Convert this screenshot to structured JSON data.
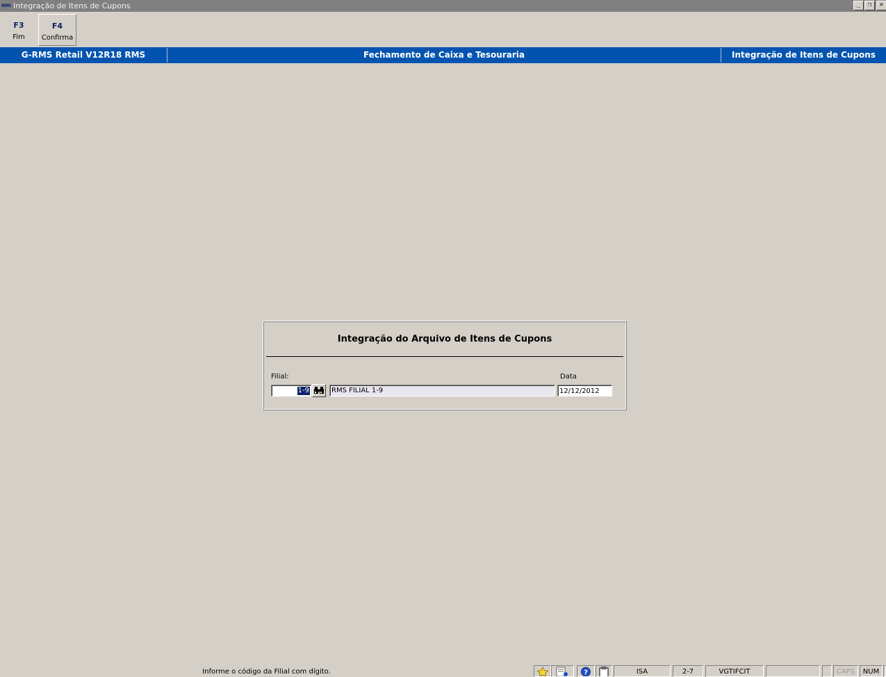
{
  "window": {
    "app_icon_text": "RMS",
    "title": "Integração de Itens de Cupons",
    "controls": {
      "minimize": "_",
      "restore": "❐",
      "close": "✕"
    }
  },
  "toolbar": {
    "buttons": [
      {
        "key": "F3",
        "label": "Fim"
      },
      {
        "key": "F4",
        "label": "Confirma"
      }
    ]
  },
  "header": {
    "system": "G-RMS Retail V12R18 RMS",
    "module": "Fechamento de Caixa e Tesouraria",
    "screen": "Integração de Itens de Cupons",
    "background_color": "#0054b0"
  },
  "form": {
    "title": "Integração do Arquivo de Itens de Cupons",
    "filial_label": "Filial:",
    "filial_value": "1-9",
    "filial_lookup_icon": "binoculars-icon",
    "filial_description": "RMS FILIAL 1-9",
    "data_label": "Data",
    "data_value": "12/12/2012"
  },
  "statusbar": {
    "message": "Informe o código da Filial com dígito.",
    "icons": [
      "favorite-star-icon",
      "notes-icon",
      "help-icon",
      "clipboard-icon"
    ],
    "user": "ISA",
    "code": "2-7",
    "program": "VGTIFCIT",
    "caps": "CAPS",
    "num": "NUM"
  }
}
